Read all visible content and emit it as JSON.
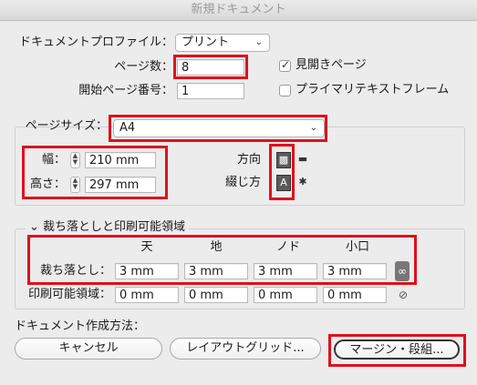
{
  "window": {
    "title": "新規ドキュメント"
  },
  "profile": {
    "label": "ドキュメントプロファイル：",
    "value": "プリント"
  },
  "pages": {
    "label": "ページ数：",
    "value": "8"
  },
  "facing": {
    "label": "見開きページ",
    "checked": true
  },
  "start_page": {
    "label": "開始ページ番号：",
    "value": "1"
  },
  "primary_text": {
    "label": "プライマリテキストフレーム",
    "checked": false
  },
  "page_size": {
    "label": "ページサイズ：",
    "value": "A4"
  },
  "width": {
    "label": "幅：",
    "value": "210 mm"
  },
  "height": {
    "label": "高さ：",
    "value": "297 mm"
  },
  "orientation": {
    "label": "方向"
  },
  "binding": {
    "label": "綴じ方"
  },
  "bleed_section": {
    "title": "裁ち落としと印刷可能領域",
    "headers": [
      "天",
      "地",
      "ノド",
      "小口"
    ]
  },
  "bleed": {
    "label": "裁ち落とし：",
    "values": [
      "3 mm",
      "3 mm",
      "3 mm",
      "3 mm"
    ]
  },
  "slug": {
    "label": "印刷可能領域：",
    "values": [
      "0 mm",
      "0 mm",
      "0 mm",
      "0 mm"
    ]
  },
  "create_method": {
    "label": "ドキュメント作成方法："
  },
  "buttons": {
    "cancel": "キャンセル",
    "layout_grid": "レイアウトグリッド...",
    "margins": "マージン・段組..."
  },
  "colors": {
    "highlight": "#e0101c"
  }
}
